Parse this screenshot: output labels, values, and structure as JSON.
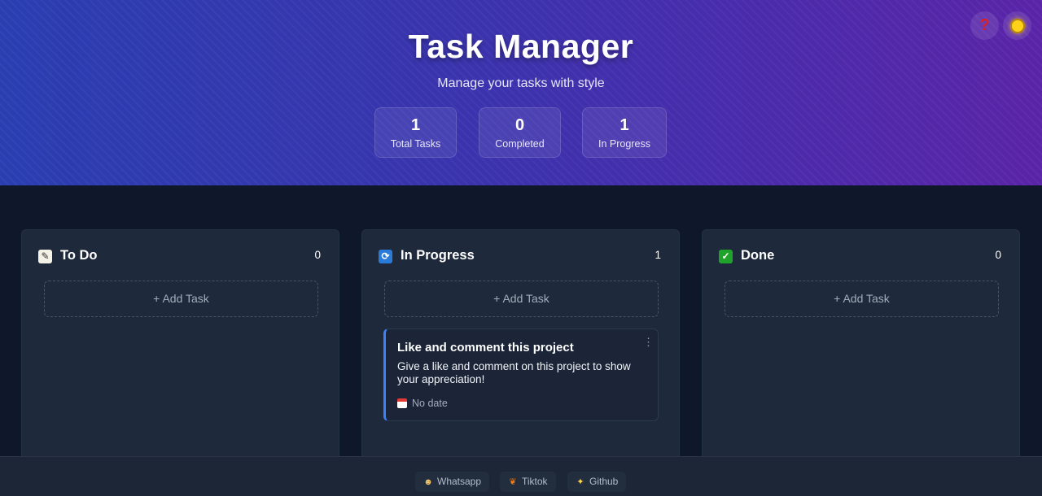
{
  "header": {
    "title": "Task Manager",
    "subtitle": "Manage your tasks with style",
    "stats": [
      {
        "value": "1",
        "label": "Total Tasks"
      },
      {
        "value": "0",
        "label": "Completed"
      },
      {
        "value": "1",
        "label": "In Progress"
      }
    ],
    "help_icon": "question-mark-icon",
    "theme_icon": "sun-icon"
  },
  "columns": [
    {
      "icon": "memo-icon",
      "title": "To Do",
      "count": "0",
      "add_label": "+ Add Task"
    },
    {
      "icon": "refresh-icon",
      "title": "In Progress",
      "count": "1",
      "add_label": "+ Add Task"
    },
    {
      "icon": "check-icon",
      "title": "Done",
      "count": "0",
      "add_label": "+ Add Task"
    }
  ],
  "task": {
    "title": "Like and comment this project",
    "description": "Give a like and comment on this project to show your appreciation!",
    "date": "No date",
    "accent": "#3b82f6"
  },
  "footer": {
    "links": [
      {
        "label": "Whatsapp",
        "icon": "person-icon"
      },
      {
        "label": "Tiktok",
        "icon": "butterfly-icon"
      },
      {
        "label": "Github",
        "icon": "sparkles-icon"
      }
    ]
  }
}
